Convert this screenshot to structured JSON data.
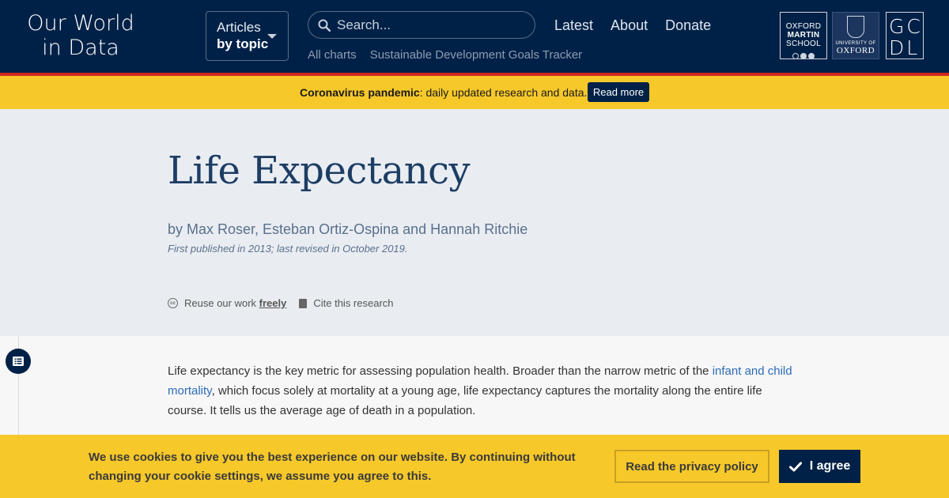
{
  "header": {
    "logo_line1": "Our World",
    "logo_line2": "in Data",
    "topics_line1": "Articles",
    "topics_line2": "by topic",
    "search_placeholder": "Search...",
    "nav": [
      "Latest",
      "About",
      "Donate"
    ],
    "subnav": [
      "All charts",
      "Sustainable Development Goals Tracker"
    ],
    "partners": {
      "oms": [
        "OXFORD",
        "MARTIN",
        "SCHOOL"
      ],
      "oxford_small": "UNIVERSITY OF",
      "oxford_name": "OXFORD",
      "gcdl_line1": "GC",
      "gcdl_line2": "DL"
    }
  },
  "announcement": {
    "bold": "Coronavirus pandemic",
    "text": ": daily updated research and data.",
    "button": "Read more"
  },
  "article": {
    "title": "Life Expectancy",
    "authors": "by Max Roser, Esteban Ortiz-Ospina and Hannah Ritchie",
    "published": "First published in 2013; last revised in October 2019.",
    "reuse_prefix": "Reuse our work ",
    "reuse_link": "freely",
    "cite": "Cite this research",
    "cc_symbol": "cc",
    "body_part1": "Life expectancy is the key metric for assessing population health. Broader than the narrow metric of the ",
    "body_link": "infant and child mortality",
    "body_part2": ", which focus solely at mortality at a young age, life expectancy captures the mortality along the entire life course. It tells us the average age of death in a population."
  },
  "cookie": {
    "message": "We use cookies to give you the best experience on our website. By continuing without changing your cookie settings, we assume you agree to this.",
    "privacy_button": "Read the privacy policy",
    "agree_button": "I agree"
  },
  "colors": {
    "header_bg": "#002147",
    "accent_red": "#ce261e",
    "banner_yellow": "#f7c82a",
    "title_blue": "#1d3d63",
    "link_blue": "#2c6bb7"
  }
}
